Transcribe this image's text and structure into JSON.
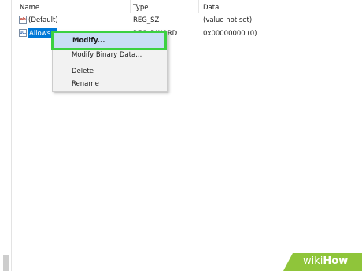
{
  "columns": {
    "name": "Name",
    "type": "Type",
    "data": "Data"
  },
  "rows": [
    {
      "icon": "string-value-icon",
      "icon_glyph": "ab",
      "name": "(Default)",
      "type": "REG_SZ",
      "data": "(value not set)"
    },
    {
      "icon": "binary-value-icon",
      "icon_glyph": "011",
      "name": "Allows",
      "type": "REG_DWORD",
      "data": "0x00000000 (0)",
      "selected": true
    }
  ],
  "context_menu": {
    "items": [
      {
        "label": "Modify...",
        "highlighted": true
      },
      {
        "label": "Modify Binary Data..."
      },
      {
        "label": "Delete"
      },
      {
        "label": "Rename"
      }
    ]
  },
  "colors": {
    "selection": "#0078d7",
    "highlight_border": "#3bd141",
    "menu_background": "#f2f2f2",
    "watermark_green": "#8fc53a"
  },
  "watermark": {
    "part1": "wiki",
    "part2": "How"
  }
}
